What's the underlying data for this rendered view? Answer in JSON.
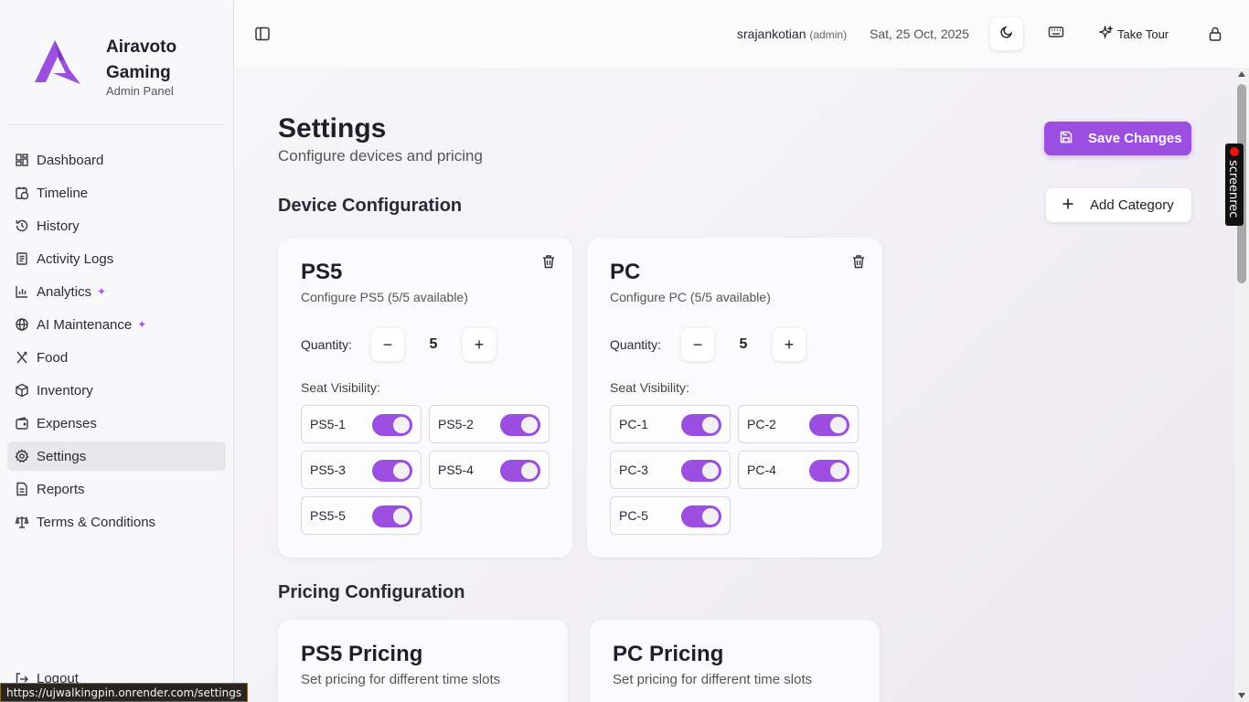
{
  "brand": {
    "name": "Airavoto Gaming",
    "subtitle": "Admin Panel"
  },
  "sidebar": {
    "items": [
      {
        "label": "Dashboard",
        "icon": "dashboard-icon"
      },
      {
        "label": "Timeline",
        "icon": "calendar-clock-icon"
      },
      {
        "label": "History",
        "icon": "history-icon"
      },
      {
        "label": "Activity Logs",
        "icon": "logs-icon"
      },
      {
        "label": "Analytics",
        "icon": "bar-chart-icon"
      },
      {
        "label": "AI Maintenance",
        "icon": "globe-icon"
      },
      {
        "label": "Food",
        "icon": "utensils-icon"
      },
      {
        "label": "Inventory",
        "icon": "package-icon"
      },
      {
        "label": "Expenses",
        "icon": "wallet-icon"
      },
      {
        "label": "Settings",
        "icon": "gear-icon",
        "active": true
      },
      {
        "label": "Reports",
        "icon": "file-icon"
      },
      {
        "label": "Terms & Conditions",
        "icon": "scale-icon"
      }
    ],
    "logout_label": "Logout",
    "accent_color": "#a855f7"
  },
  "topbar": {
    "username": "srajankotian",
    "role": "(admin)",
    "date": "Sat, 25 Oct, 2025",
    "tour_label": "Take Tour"
  },
  "page": {
    "title": "Settings",
    "subtitle": "Configure devices and pricing",
    "save_label": "Save Changes",
    "device_section_title": "Device Configuration",
    "add_category_label": "Add Category",
    "pricing_section_title": "Pricing Configuration",
    "accent_color": "#9b4ee0"
  },
  "devices": [
    {
      "title": "PS5",
      "subtitle": "Configure PS5 (5/5 available)",
      "quantity_label": "Quantity:",
      "quantity": "5",
      "seat_label": "Seat Visibility:",
      "seats": [
        {
          "name": "PS5-1",
          "on": true
        },
        {
          "name": "PS5-2",
          "on": true
        },
        {
          "name": "PS5-3",
          "on": true
        },
        {
          "name": "PS5-4",
          "on": true
        },
        {
          "name": "PS5-5",
          "on": true
        }
      ]
    },
    {
      "title": "PC",
      "subtitle": "Configure PC (5/5 available)",
      "quantity_label": "Quantity:",
      "quantity": "5",
      "seat_label": "Seat Visibility:",
      "seats": [
        {
          "name": "PC-1",
          "on": true
        },
        {
          "name": "PC-2",
          "on": true
        },
        {
          "name": "PC-3",
          "on": true
        },
        {
          "name": "PC-4",
          "on": true
        },
        {
          "name": "PC-5",
          "on": true
        }
      ]
    }
  ],
  "pricing": [
    {
      "title": "PS5 Pricing",
      "subtitle": "Set pricing for different time slots"
    },
    {
      "title": "PC Pricing",
      "subtitle": "Set pricing for different time slots"
    }
  ],
  "status_url": "https://ujwalkingpin.onrender.com/settings",
  "recorder_label": "screenrec"
}
